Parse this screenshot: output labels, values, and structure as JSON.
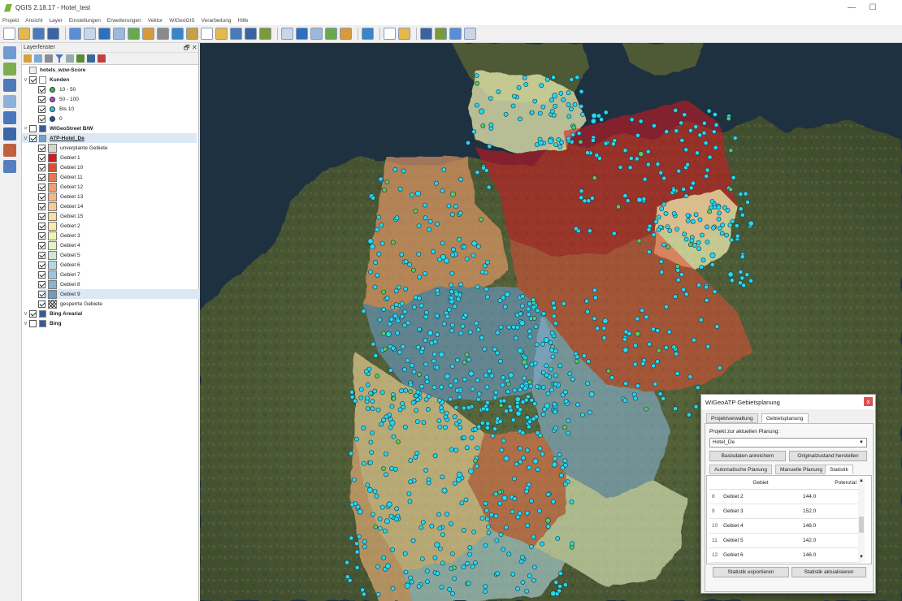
{
  "window": {
    "title": "QGIS 2.18.17 - Hotel_test",
    "minimize": "—",
    "maximize": "☐"
  },
  "menus": [
    "Projekt",
    "Ansicht",
    "Layer",
    "Einstellungen",
    "Erweiterungen",
    "Vektor",
    "WIGeoGIS",
    "Verarbeitung",
    "Hilfe"
  ],
  "toolbar_icons": [
    "new-project-icon",
    "open-project-icon",
    "save-project-icon",
    "save-as-icon",
    "sep",
    "pan-touch-icon",
    "pan-hand-icon",
    "pan-to-selection-icon",
    "zoom-in-icon",
    "zoom-out-icon",
    "zoom-native-icon",
    "zoom-full-icon",
    "zoom-selection-icon",
    "zoom-layer-icon",
    "zoom-last-icon",
    "zoom-next-icon",
    "new-bookmark-icon",
    "show-bookmarks-icon",
    "refresh-icon",
    "sep",
    "identify-icon",
    "select-features-icon",
    "select-value-icon",
    "deselect-icon",
    "measure-icon",
    "sep",
    "map-tips-icon",
    "sep",
    "layer-upload-icon",
    "layer-download-icon",
    "sep",
    "zoom-layer-blue-icon",
    "map-blue-icon",
    "map-gear-icon",
    "sum-icon"
  ],
  "left_toolbar_icons": [
    "add-vector-layer-icon",
    "add-raster-layer-icon",
    "add-postgis-icon",
    "add-spatialite-icon",
    "add-wms-icon",
    "add-wcs-icon",
    "add-delimited-text-icon",
    "add-oracle-icon"
  ],
  "layer_panel": {
    "title": "Layerfenster",
    "float": "🗗",
    "close": "✕",
    "rows": [
      {
        "label": "hotels_wzw-Score",
        "indent": 0,
        "checkbox": false,
        "expander": "",
        "icon": "table-layer-icon",
        "bold": true
      },
      {
        "label": "Kunden",
        "indent": 0,
        "checkbox": true,
        "expander": "v",
        "icon": "point-layer-icon",
        "bold": true
      },
      {
        "label": "10 - 50",
        "indent": 1,
        "checkbox": true,
        "dot": "#3cb54a"
      },
      {
        "label": "50 - 100",
        "indent": 1,
        "checkbox": true,
        "dot": "#c040c8"
      },
      {
        "label": "Bis 10",
        "indent": 1,
        "checkbox": true,
        "dot": "#28c8f0"
      },
      {
        "label": "0",
        "indent": 1,
        "checkbox": true,
        "dot": "#2a4db0"
      },
      {
        "label": "WIGeoStreet B/W",
        "indent": 0,
        "checkbox": false,
        "expander": ">",
        "icon": "raster-layer-icon",
        "bold": true
      },
      {
        "label": "ATP-Hotel_De",
        "indent": 0,
        "checkbox": true,
        "expander": "v",
        "icon": "polygon-layer-icon",
        "bold": true,
        "underline": true,
        "selected": true
      },
      {
        "label": "unverplante Gebiete",
        "indent": 1,
        "checkbox": true,
        "sq": "#d6d6c6"
      },
      {
        "label": "Gebiet 1",
        "indent": 1,
        "checkbox": true,
        "sq": "#d7191c"
      },
      {
        "label": "Gebiet 10",
        "indent": 1,
        "checkbox": true,
        "sq": "#e14b36"
      },
      {
        "label": "Gebiet 11",
        "indent": 1,
        "checkbox": true,
        "sq": "#ea7750"
      },
      {
        "label": "Gebiet 12",
        "indent": 1,
        "checkbox": true,
        "sq": "#f29e6a"
      },
      {
        "label": "Gebiet 13",
        "indent": 1,
        "checkbox": true,
        "sq": "#f7b77e"
      },
      {
        "label": "Gebiet 14",
        "indent": 1,
        "checkbox": true,
        "sq": "#fbca8e"
      },
      {
        "label": "Gebiet 15",
        "indent": 1,
        "checkbox": true,
        "sq": "#fddc9e"
      },
      {
        "label": "Gebiet 2",
        "indent": 1,
        "checkbox": true,
        "sq": "#fdeaa9"
      },
      {
        "label": "Gebiet 3",
        "indent": 1,
        "checkbox": true,
        "sq": "#f2f2b4"
      },
      {
        "label": "Gebiet 4",
        "indent": 1,
        "checkbox": true,
        "sq": "#e4f1c0"
      },
      {
        "label": "Gebiet 5",
        "indent": 1,
        "checkbox": true,
        "sq": "#cfe8d4"
      },
      {
        "label": "Gebiet 6",
        "indent": 1,
        "checkbox": true,
        "sq": "#b3d9df"
      },
      {
        "label": "Gebiet 7",
        "indent": 1,
        "checkbox": true,
        "sq": "#9dc6dc"
      },
      {
        "label": "Gebiet 8",
        "indent": 1,
        "checkbox": true,
        "sq": "#87b2d2"
      },
      {
        "label": "Gebiet 9",
        "indent": 1,
        "checkbox": true,
        "sq": "#6b9bc6",
        "selected": true
      },
      {
        "label": "gesperrte Gebiete",
        "indent": 1,
        "checkbox": true,
        "sq": "hatch"
      },
      {
        "label": "Bing Arearial",
        "indent": 0,
        "checkbox": true,
        "expander": "v",
        "icon": "raster-layer-icon",
        "bold": true
      },
      {
        "label": "Bing",
        "indent": 0,
        "checkbox": false,
        "expander": "v",
        "icon": "raster-layer-icon",
        "bold": true
      }
    ]
  },
  "dialog": {
    "title": "WIGeoATP Gebietsplanung",
    "close": "x",
    "tabs": [
      "Projektverwaltung",
      "Gebietsplanung"
    ],
    "active_tab": "Gebietsplanung",
    "project_label": "Projekt zur aktuellen Planung:",
    "project_value": "Hotel_De",
    "btn_enrich": "Basisdaten anreichern",
    "btn_restore": "Originalzustand herstellen",
    "subtabs": [
      "Automatische Planung",
      "Manuelle Planung",
      "Statistik"
    ],
    "active_subtab": "Statistik",
    "table_headers": [
      "",
      "Gebiet",
      "Potenzial"
    ],
    "table_rows": [
      {
        "idx": "8",
        "gebiet": "Gebiet 2",
        "potenzial": "144.0"
      },
      {
        "idx": "9",
        "gebiet": "Gebiet 3",
        "potenzial": "152.0"
      },
      {
        "idx": "10",
        "gebiet": "Gebiet 4",
        "potenzial": "146.0"
      },
      {
        "idx": "11",
        "gebiet": "Gebiet 5",
        "potenzial": "142.0"
      },
      {
        "idx": "12",
        "gebiet": "Gebiet 6",
        "potenzial": "146.0"
      }
    ],
    "btn_export": "Statistik exportieren",
    "btn_update": "Statistik aktualisieren"
  },
  "colors": {
    "accent": "#2a6fc4",
    "point_fill": "#28d7f0",
    "point_stroke": "#0a3a4a",
    "point_green": "#5cc85a"
  }
}
